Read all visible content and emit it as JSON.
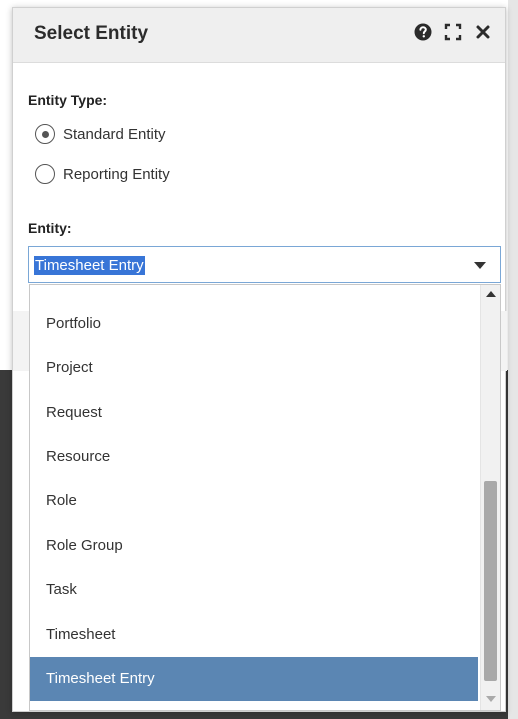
{
  "dialog": {
    "title": "Select Entity",
    "icons": [
      "help-icon",
      "expand-icon",
      "close-icon"
    ]
  },
  "entity_type": {
    "label": "Entity Type:",
    "options": [
      {
        "label": "Standard Entity",
        "checked": true
      },
      {
        "label": "Reporting Entity",
        "checked": false
      }
    ]
  },
  "entity": {
    "label": "Entity:",
    "selected_value": "Timesheet Entry",
    "options": [
      {
        "label": "Portfolio",
        "selected": false
      },
      {
        "label": "Project",
        "selected": false
      },
      {
        "label": "Request",
        "selected": false
      },
      {
        "label": "Resource",
        "selected": false
      },
      {
        "label": "Role",
        "selected": false
      },
      {
        "label": "Role Group",
        "selected": false
      },
      {
        "label": "Task",
        "selected": false
      },
      {
        "label": "Timesheet",
        "selected": false
      },
      {
        "label": "Timesheet Entry",
        "selected": true
      }
    ]
  },
  "colors": {
    "header_bg": "#efefef",
    "selection_highlight": "#3875d7",
    "selected_item": "#5b86b3"
  }
}
